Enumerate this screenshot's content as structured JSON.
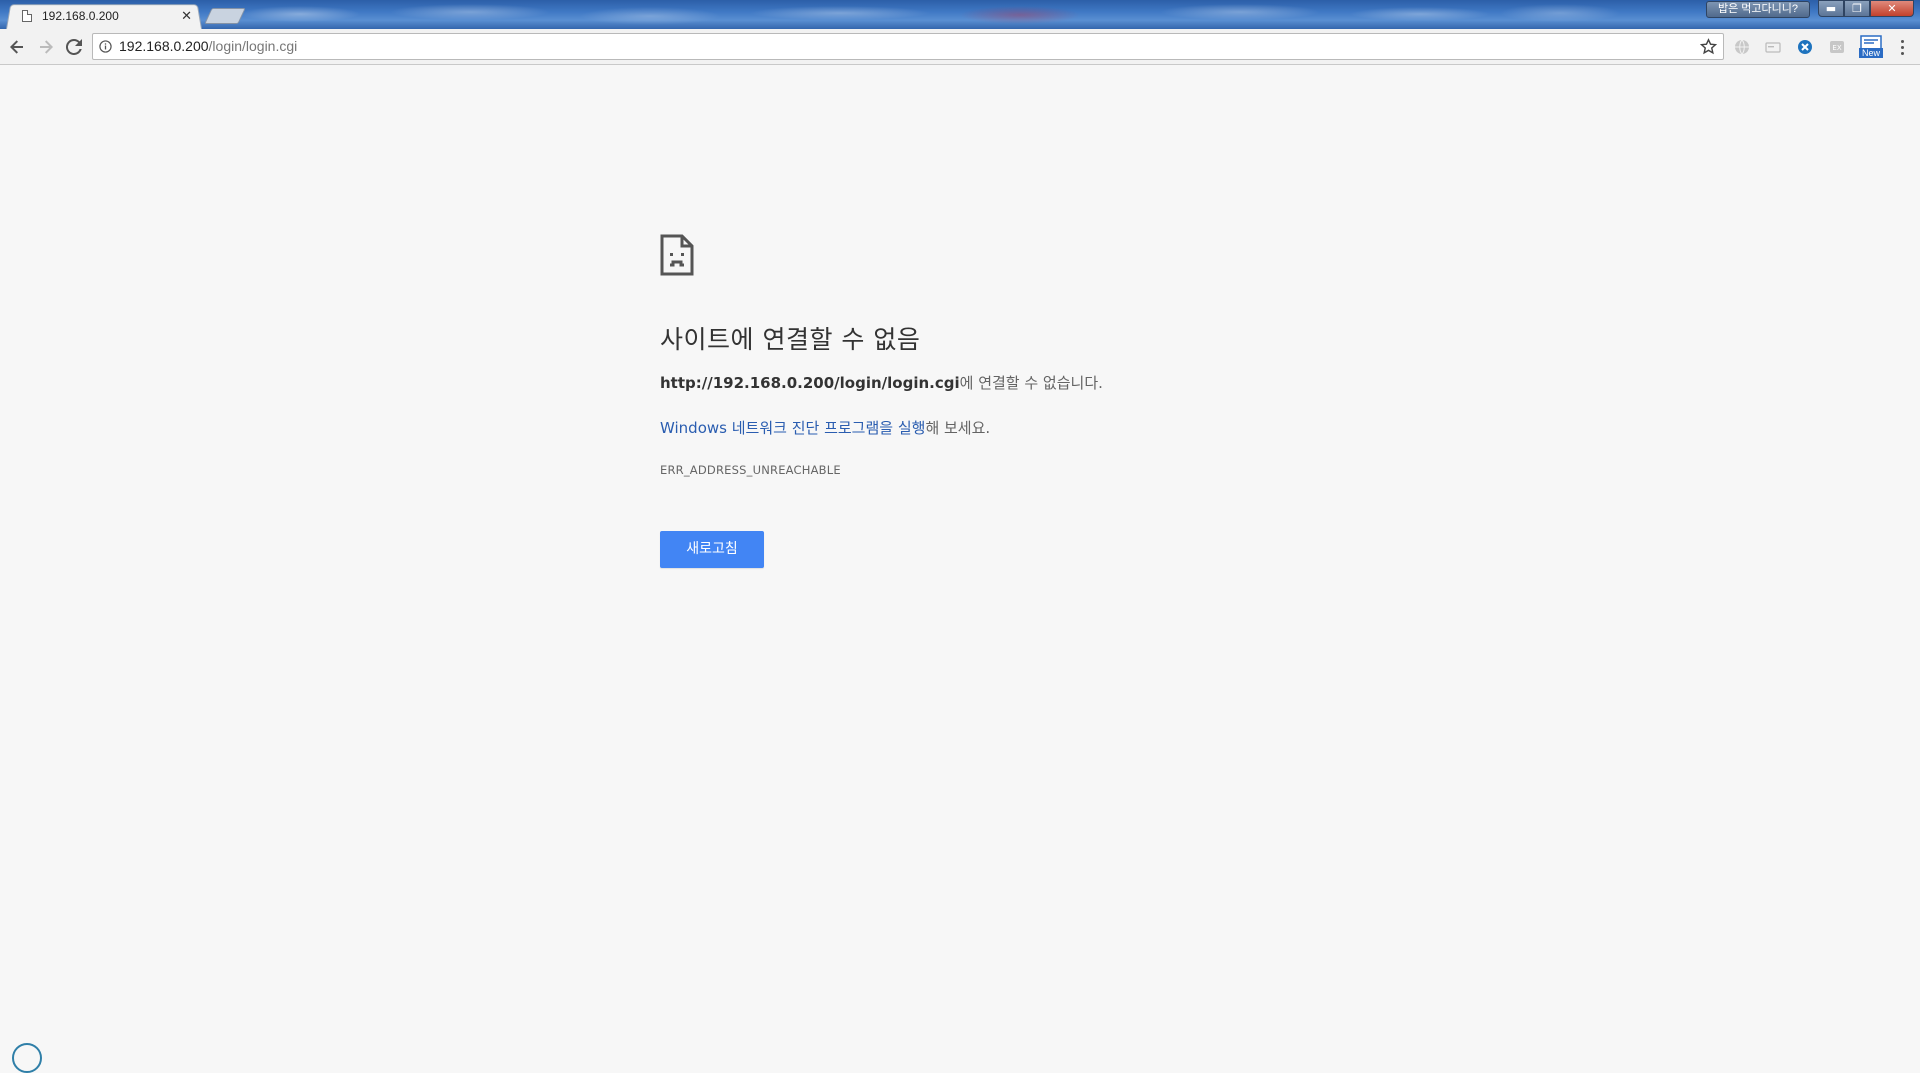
{
  "browser": {
    "tab": {
      "title": "192.168.0.200",
      "close_glyph": "✕"
    },
    "user_badge": "밥은 먹고다니니?",
    "window_controls": {
      "minimize": "▬",
      "maximize": "❐",
      "close": "✕"
    },
    "omnibox": {
      "host": "192.168.0.200",
      "path": "/login/login.cgi"
    },
    "extensions": [
      {
        "icon": "globe-icon"
      },
      {
        "icon": "card-icon"
      },
      {
        "icon": "blue-x-icon"
      },
      {
        "icon": "ext-icon"
      },
      {
        "icon": "new-badge-icon",
        "label": "New"
      }
    ]
  },
  "error_page": {
    "heading": "사이트에 연결할 수 없음",
    "url_bold": "http://192.168.0.200/login/login.cgi",
    "url_suffix": "에 연결할 수 없습니다.",
    "diagnostic_link": "Windows 네트워크 진단 프로그램을 실행",
    "diagnostic_suffix": "해 보세요.",
    "error_code": "ERR_ADDRESS_UNREACHABLE",
    "reload_button": "새로고침"
  },
  "colors": {
    "accent": "#4285f4",
    "link": "#2a5db0",
    "page_bg": "#f7f7f7"
  }
}
